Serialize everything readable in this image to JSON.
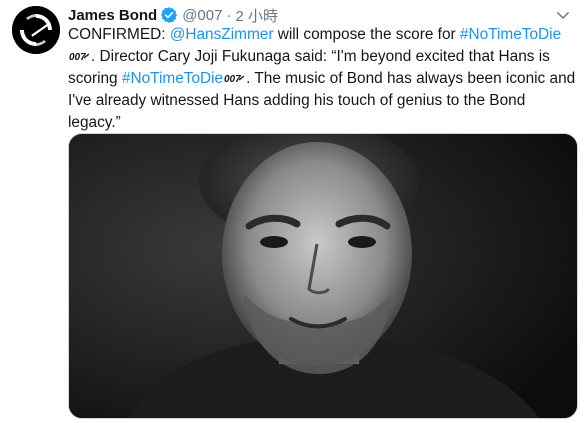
{
  "tweet": {
    "display_name": "James Bond",
    "handle": "@007",
    "separator": "·",
    "timestamp": "2 小時",
    "text": {
      "s1": "CONFIRMED: ",
      "mention": "@HansZimmer",
      "s2": " will compose the score for ",
      "hashtag1": "#NoTimeToDie",
      "s3": ". Director Cary Joji Fukunaga said: “I'm beyond excited that Hans is scoring ",
      "hashtag2": "#NoTimeToDie",
      "s4": ". The music of Bond has always been iconic and I've already witnessed Hans adding his touch of genius to the Bond legacy.”"
    },
    "hashtag_emoji": "007-hashflag-icon",
    "image": "black-and-white-portrait-photo"
  },
  "colors": {
    "link": "#1b95e0",
    "text": "#14171a",
    "secondary": "#657786",
    "verified": "#1da1f2"
  }
}
